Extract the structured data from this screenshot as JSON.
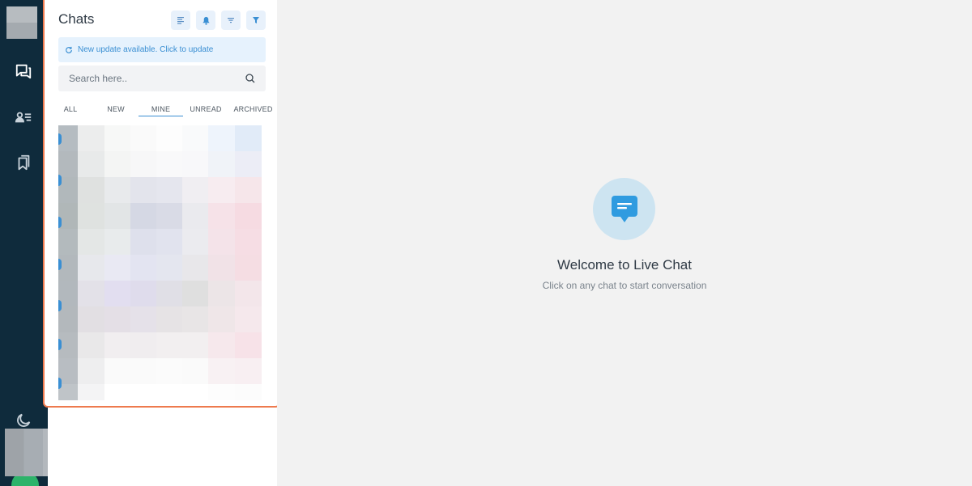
{
  "sidebar": {
    "icons": [
      "chats-icon",
      "contacts-icon",
      "bookmarks-icon",
      "dark-mode-icon"
    ]
  },
  "chat_list": {
    "title": "Chats",
    "toolbar_icons": [
      "list-view-icon",
      "notification-icon",
      "sort-icon",
      "filter-icon"
    ],
    "update_banner": "New update available. Click to update",
    "search_placeholder": "Search here..",
    "tabs": [
      {
        "label": "ALL",
        "active": false
      },
      {
        "label": "NEW",
        "active": false
      },
      {
        "label": "MINE",
        "active": true
      },
      {
        "label": "UNREAD",
        "active": false
      },
      {
        "label": "ARCHIVED",
        "active": false
      }
    ]
  },
  "welcome": {
    "title": "Welcome to Live Chat",
    "subtitle": "Click on any chat to start conversation"
  },
  "colors": {
    "rail": "#0f2b3c",
    "accent": "#3a8fd3",
    "panel_border": "#ee7a4e",
    "welcome_circle": "#cde4f1"
  }
}
